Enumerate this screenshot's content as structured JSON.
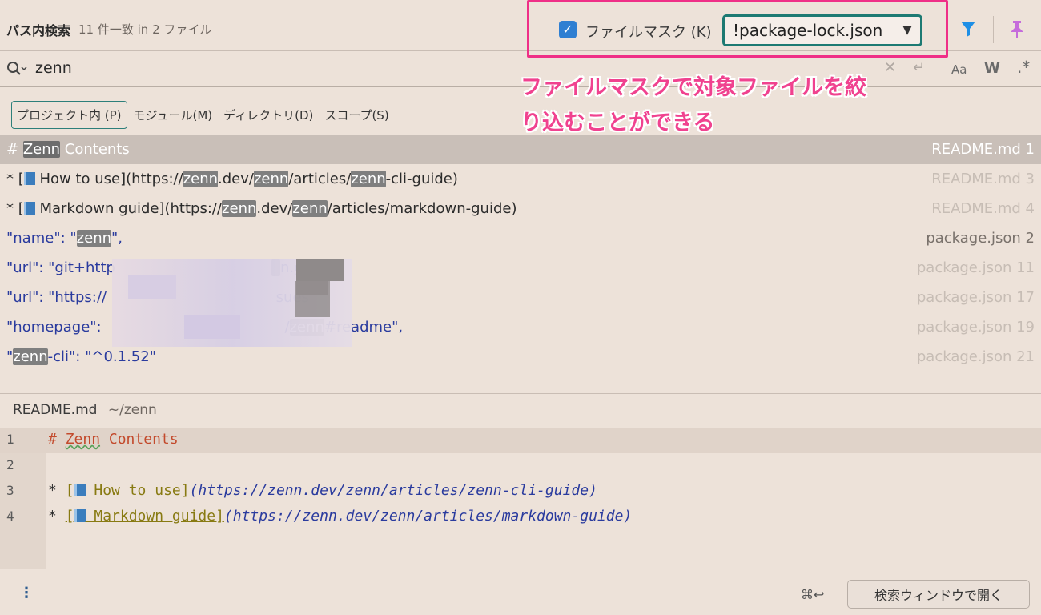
{
  "header": {
    "title": "パス内検索",
    "match_count": "11 件一致 in 2 ファイル"
  },
  "file_mask": {
    "checked": true,
    "label": "ファイルマスク (K)",
    "value": "!package-lock.json"
  },
  "icons": {
    "filter": "funnel-icon",
    "pin": "pin-icon",
    "search": "search-icon",
    "clear": "close-icon",
    "enter": "enter-icon",
    "match_case": "Aa",
    "words": "W",
    "regex": "*"
  },
  "search": {
    "query": "zenn"
  },
  "callout": {
    "line1": "ファイルマスクで対象ファイルを絞",
    "line2": "り込むことができる"
  },
  "scope_tabs": [
    {
      "label": "プロジェクト内 (P)",
      "active": true
    },
    {
      "label": "モジュール(M)",
      "active": false
    },
    {
      "label": "ディレクトリ(D)",
      "active": false
    },
    {
      "label": "スコープ(S)",
      "active": false
    }
  ],
  "results": [
    {
      "text": "# Zenn Contents",
      "file": "README.md 1"
    },
    {
      "text": "* [📘 How to use](https://zenn.dev/zenn/articles/zenn-cli-guide)",
      "file": "README.md 3"
    },
    {
      "text": "* [📘 Markdown guide](https://zenn.dev/zenn/articles/markdown-guide)",
      "file": "README.md 4"
    },
    {
      "text": "\"name\": \"zenn\",",
      "file": "package.json 2"
    },
    {
      "text": "\"url\": \"git+http n.git\"",
      "file": "package.json 11"
    },
    {
      "text": "\"url\": \"https:// sues\"",
      "file": "package.json 17"
    },
    {
      "text": "\"homepage\": /zenn#readme\",",
      "file": "package.json 19"
    },
    {
      "text": "\"zenn-cli\": \"^0.1.52\"",
      "file": "package.json 21"
    }
  ],
  "preview": {
    "file_name": "README.md",
    "path": "~/zenn",
    "lines": [
      {
        "num": "1",
        "text": "# Zenn Contents"
      },
      {
        "num": "2",
        "text": ""
      },
      {
        "num": "3",
        "text": "* [📘 How to use](https://zenn.dev/zenn/articles/zenn-cli-guide)"
      },
      {
        "num": "4",
        "text": "* [📘 Markdown guide](https://zenn.dev/zenn/articles/markdown-guide)"
      }
    ]
  },
  "footer": {
    "shortcut": "⌘↩",
    "open_button": "検索ウィンドウで開く"
  },
  "colors": {
    "background": "#ede2d9",
    "highlight_box": "#ef2f87",
    "callout_text": "#f0428f",
    "select_border": "#1d7a73",
    "checkbox": "#2f7fd2",
    "code_string": "#2a3b9e"
  }
}
